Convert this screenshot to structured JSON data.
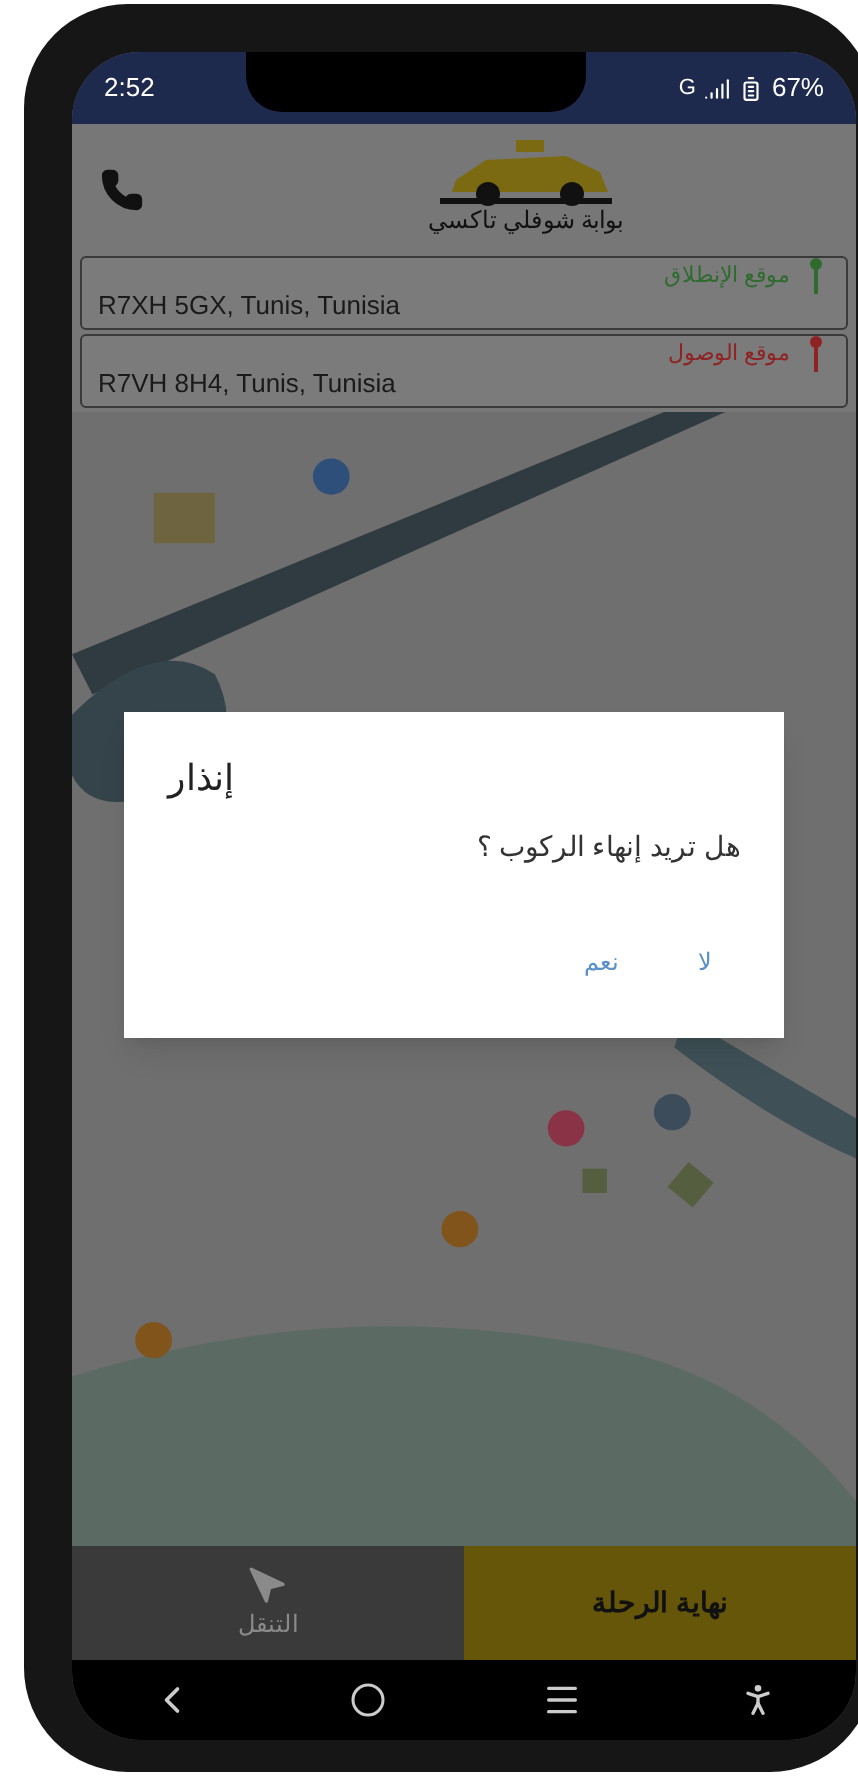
{
  "status_bar": {
    "time": "2:52",
    "network": "G",
    "battery": "67%"
  },
  "header": {
    "logo_text": "بوابة شوفلي تاكسي"
  },
  "locations": [
    {
      "label": "موقع الإنطلاق",
      "address": "R7XH 5GX, Tunis, Tunisia",
      "color": "#2f6b2f"
    },
    {
      "label": "موقع الوصول",
      "address": "R7VH 8H4, Tunis, Tunisia",
      "color": "#8f2323"
    }
  ],
  "dialog": {
    "title": "إنذار",
    "message": "هل تريد إنهاء الركوب ؟",
    "buttons": [
      "لا",
      "نعم"
    ]
  },
  "bottom_bar": {
    "navigate_label": "التنقل",
    "end_trip_label": "نهاية الرحلة"
  }
}
